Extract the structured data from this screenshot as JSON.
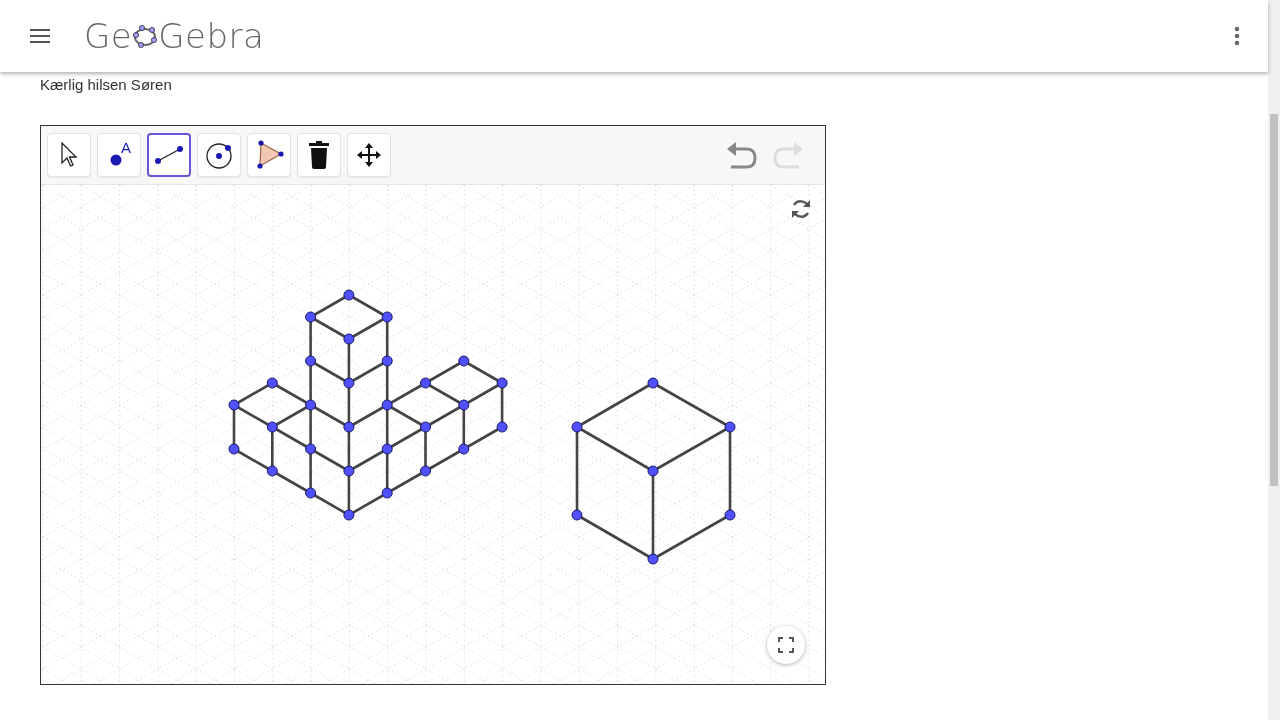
{
  "header": {
    "logo": [
      "Ge",
      "Gebra"
    ]
  },
  "greeting": "Kærlig hilsen Søren",
  "applet": {
    "tools": [
      {
        "kind": "move",
        "selected": false
      },
      {
        "kind": "point",
        "selected": false,
        "glyph": "A"
      },
      {
        "kind": "segment",
        "selected": true
      },
      {
        "kind": "circle",
        "selected": false
      },
      {
        "kind": "polygon",
        "selected": false
      },
      {
        "kind": "delete",
        "selected": false
      },
      {
        "kind": "pan",
        "selected": false
      }
    ],
    "undo": {
      "disabled": false
    },
    "redo": {
      "disabled": true
    }
  }
}
